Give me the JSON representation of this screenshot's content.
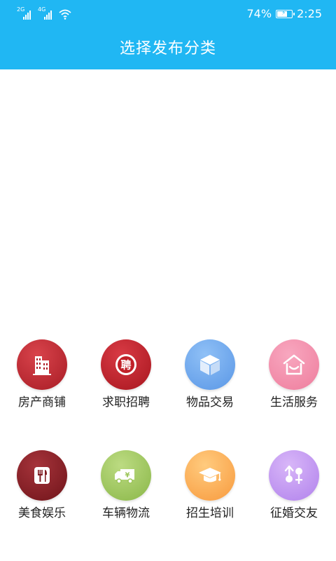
{
  "status_bar": {
    "signal1_network": "2G",
    "signal2_network": "4G",
    "battery_percent": "74%",
    "battery_level": 0.74,
    "time": "2:25"
  },
  "header": {
    "title": "选择发布分类"
  },
  "colors": {
    "header_bg": "#20b7f3",
    "real_estate": "#b0202a",
    "jobs": "#b51d26",
    "goods": "#6aa7ef",
    "life_services": "#f38aa9",
    "food": "#7e1a20",
    "vehicles": "#9dc65a",
    "education": "#fdb05a",
    "dating": "#c59af2"
  },
  "categories": [
    {
      "label": "房产商铺",
      "icon": "building-icon"
    },
    {
      "label": "求职招聘",
      "icon": "recruit-icon",
      "icon_text": "聘"
    },
    {
      "label": "物品交易",
      "icon": "box-icon"
    },
    {
      "label": "生活服务",
      "icon": "house-smile-icon"
    },
    {
      "label": "美食娱乐",
      "icon": "fork-knife-icon"
    },
    {
      "label": "车辆物流",
      "icon": "truck-icon",
      "icon_text": "¥"
    },
    {
      "label": "招生培训",
      "icon": "graduation-cap-icon"
    },
    {
      "label": "征婚交友",
      "icon": "gender-symbols-icon"
    }
  ]
}
